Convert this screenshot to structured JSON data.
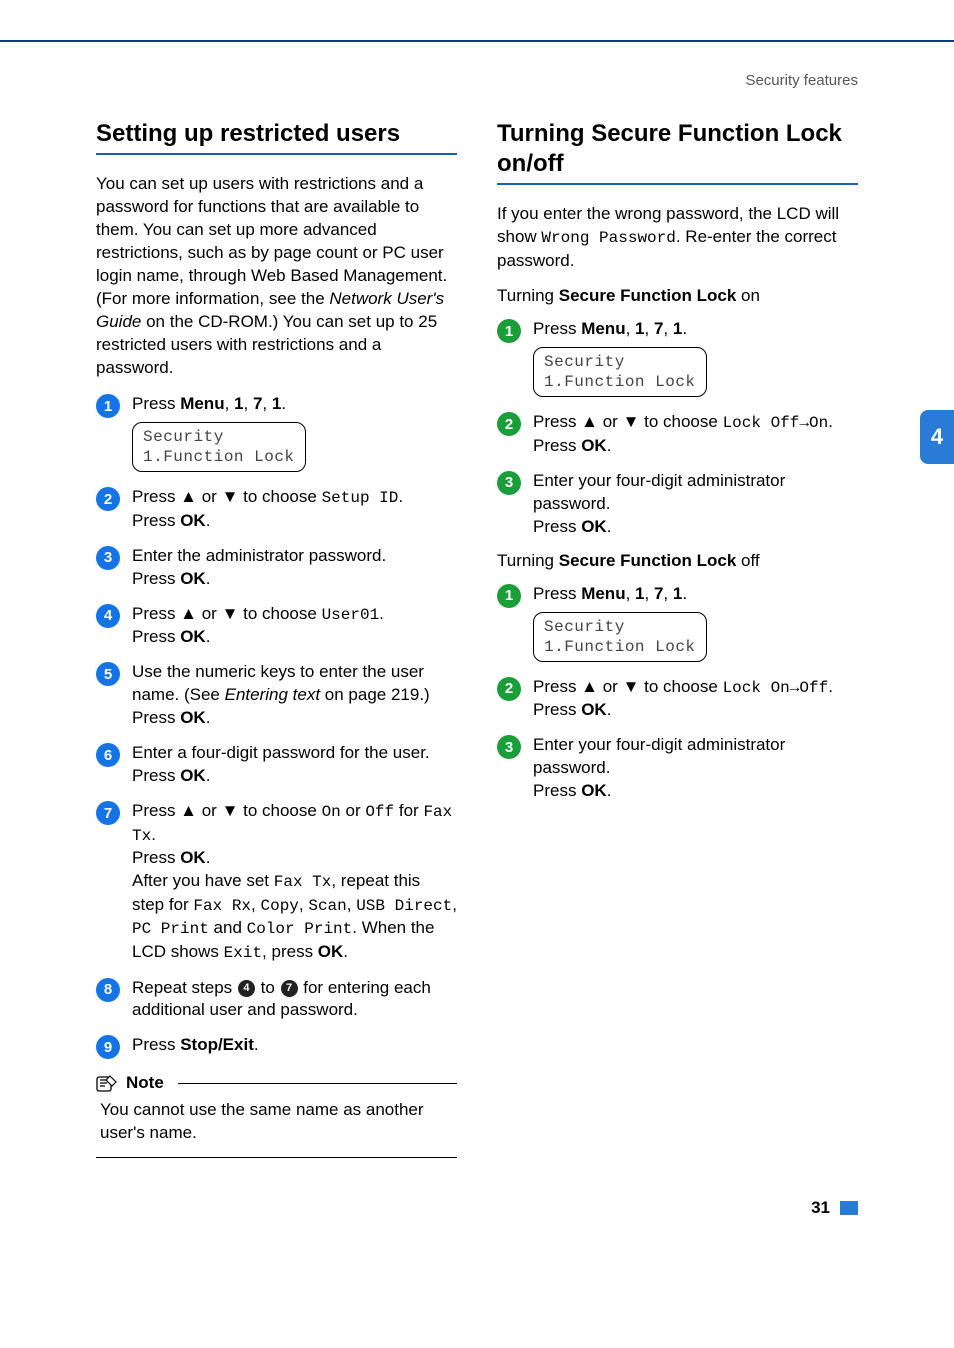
{
  "header": {
    "section": "Security features"
  },
  "side_tab": "4",
  "page_number": "31",
  "left": {
    "title": "Setting up restricted users",
    "intro_parts": {
      "a": "You can set up users with restrictions and a password for functions that are available to them. You can set up more advanced restrictions, such as by page count or PC user login name, through Web Based Management. (For more information, see the ",
      "b": "Network User's Guide",
      "c": " on the CD-ROM.) You can set up to 25 restricted users with restrictions and a password."
    },
    "steps": {
      "s1": {
        "a": "Press ",
        "b": "Menu",
        "c": ", ",
        "d": "1",
        "e": ", ",
        "f": "7",
        "g": ", ",
        "h": "1",
        "i": "."
      },
      "lcd1": "Security\n1.Function Lock",
      "s2": {
        "a": "Press ▲ or ▼ to choose ",
        "mono": "Setup ID",
        "b": ".",
        "c": "Press ",
        "d": "OK",
        "e": "."
      },
      "s3": {
        "a": "Enter the administrator password.",
        "b": "Press ",
        "c": "OK",
        "d": "."
      },
      "s4": {
        "a": "Press ▲ or ▼ to choose ",
        "mono": "User01",
        "b": ".",
        "c": "Press ",
        "d": "OK",
        "e": "."
      },
      "s5": {
        "a": "Use the numeric keys to enter the user name. (See ",
        "ital": "Entering text",
        "b": " on page 219.)",
        "c": "Press ",
        "d": "OK",
        "e": "."
      },
      "s6": {
        "a": "Enter a four-digit password for the user.",
        "b": "Press ",
        "c": "OK",
        "d": "."
      },
      "s7": {
        "a": "Press ▲ or ▼ to choose ",
        "on": "On",
        "or": " or ",
        "off": "Off",
        "for": " for ",
        "faxtx": "Fax Tx",
        "dot1": ".",
        "po": "Press ",
        "ok": "OK",
        "dot2": ".",
        "after": "After you have set ",
        "faxtx2": "Fax Tx",
        "rep": ", repeat this step for ",
        "faxrx": "Fax Rx",
        "c1": ", ",
        "copy": "Copy",
        "c2": ", ",
        "scan": "Scan",
        "c3": ", ",
        "usb": "USB Direct",
        "c4": ", ",
        "pcprint": "PC Print",
        "and": " and ",
        "color": "Color Print",
        "when": ". When the LCD shows ",
        "exit": "Exit",
        "press": ", press ",
        "ok2": "OK",
        "dot3": "."
      },
      "s8": {
        "a": "Repeat steps ",
        "n1": "4",
        "to": " to ",
        "n2": "7",
        "b": " for entering each additional user and password."
      },
      "s9": {
        "a": "Press ",
        "b": "Stop/Exit",
        "c": "."
      }
    },
    "note": {
      "label": "Note",
      "text": "You cannot use the same name as another user's name."
    }
  },
  "right": {
    "title": "Turning Secure Function Lock on/off",
    "intro": {
      "a": "If you enter the wrong password, the LCD will show ",
      "mono": "Wrong Password",
      "b": ". Re-enter the correct password."
    },
    "sub_on": {
      "a": "Turning ",
      "b": "Secure Function Lock",
      "c": " on"
    },
    "on_steps": {
      "s1": {
        "a": "Press ",
        "b": "Menu",
        "c": ", ",
        "d": "1",
        "e": ", ",
        "f": "7",
        "g": ", ",
        "h": "1",
        "i": "."
      },
      "lcd1": "Security\n1.Function Lock",
      "s2": {
        "a": "Press ▲ or ▼ to choose ",
        "mono": "Lock Off→On",
        "b": ".",
        "c": "Press ",
        "d": "OK",
        "e": "."
      },
      "s3": {
        "a": "Enter your four-digit administrator password.",
        "b": "Press ",
        "c": "OK",
        "d": "."
      }
    },
    "sub_off": {
      "a": "Turning ",
      "b": "Secure Function Lock",
      "c": " off"
    },
    "off_steps": {
      "s1": {
        "a": "Press ",
        "b": "Menu",
        "c": ", ",
        "d": "1",
        "e": ", ",
        "f": "7",
        "g": ", ",
        "h": "1",
        "i": "."
      },
      "lcd1": "Security\n1.Function Lock",
      "s2": {
        "a": "Press ▲ or ▼ to choose ",
        "mono": "Lock On→Off",
        "b": ".",
        "c": "Press ",
        "d": "OK",
        "e": "."
      },
      "s3": {
        "a": "Enter your four-digit administrator password.",
        "b": "Press ",
        "c": "OK",
        "d": "."
      }
    }
  }
}
